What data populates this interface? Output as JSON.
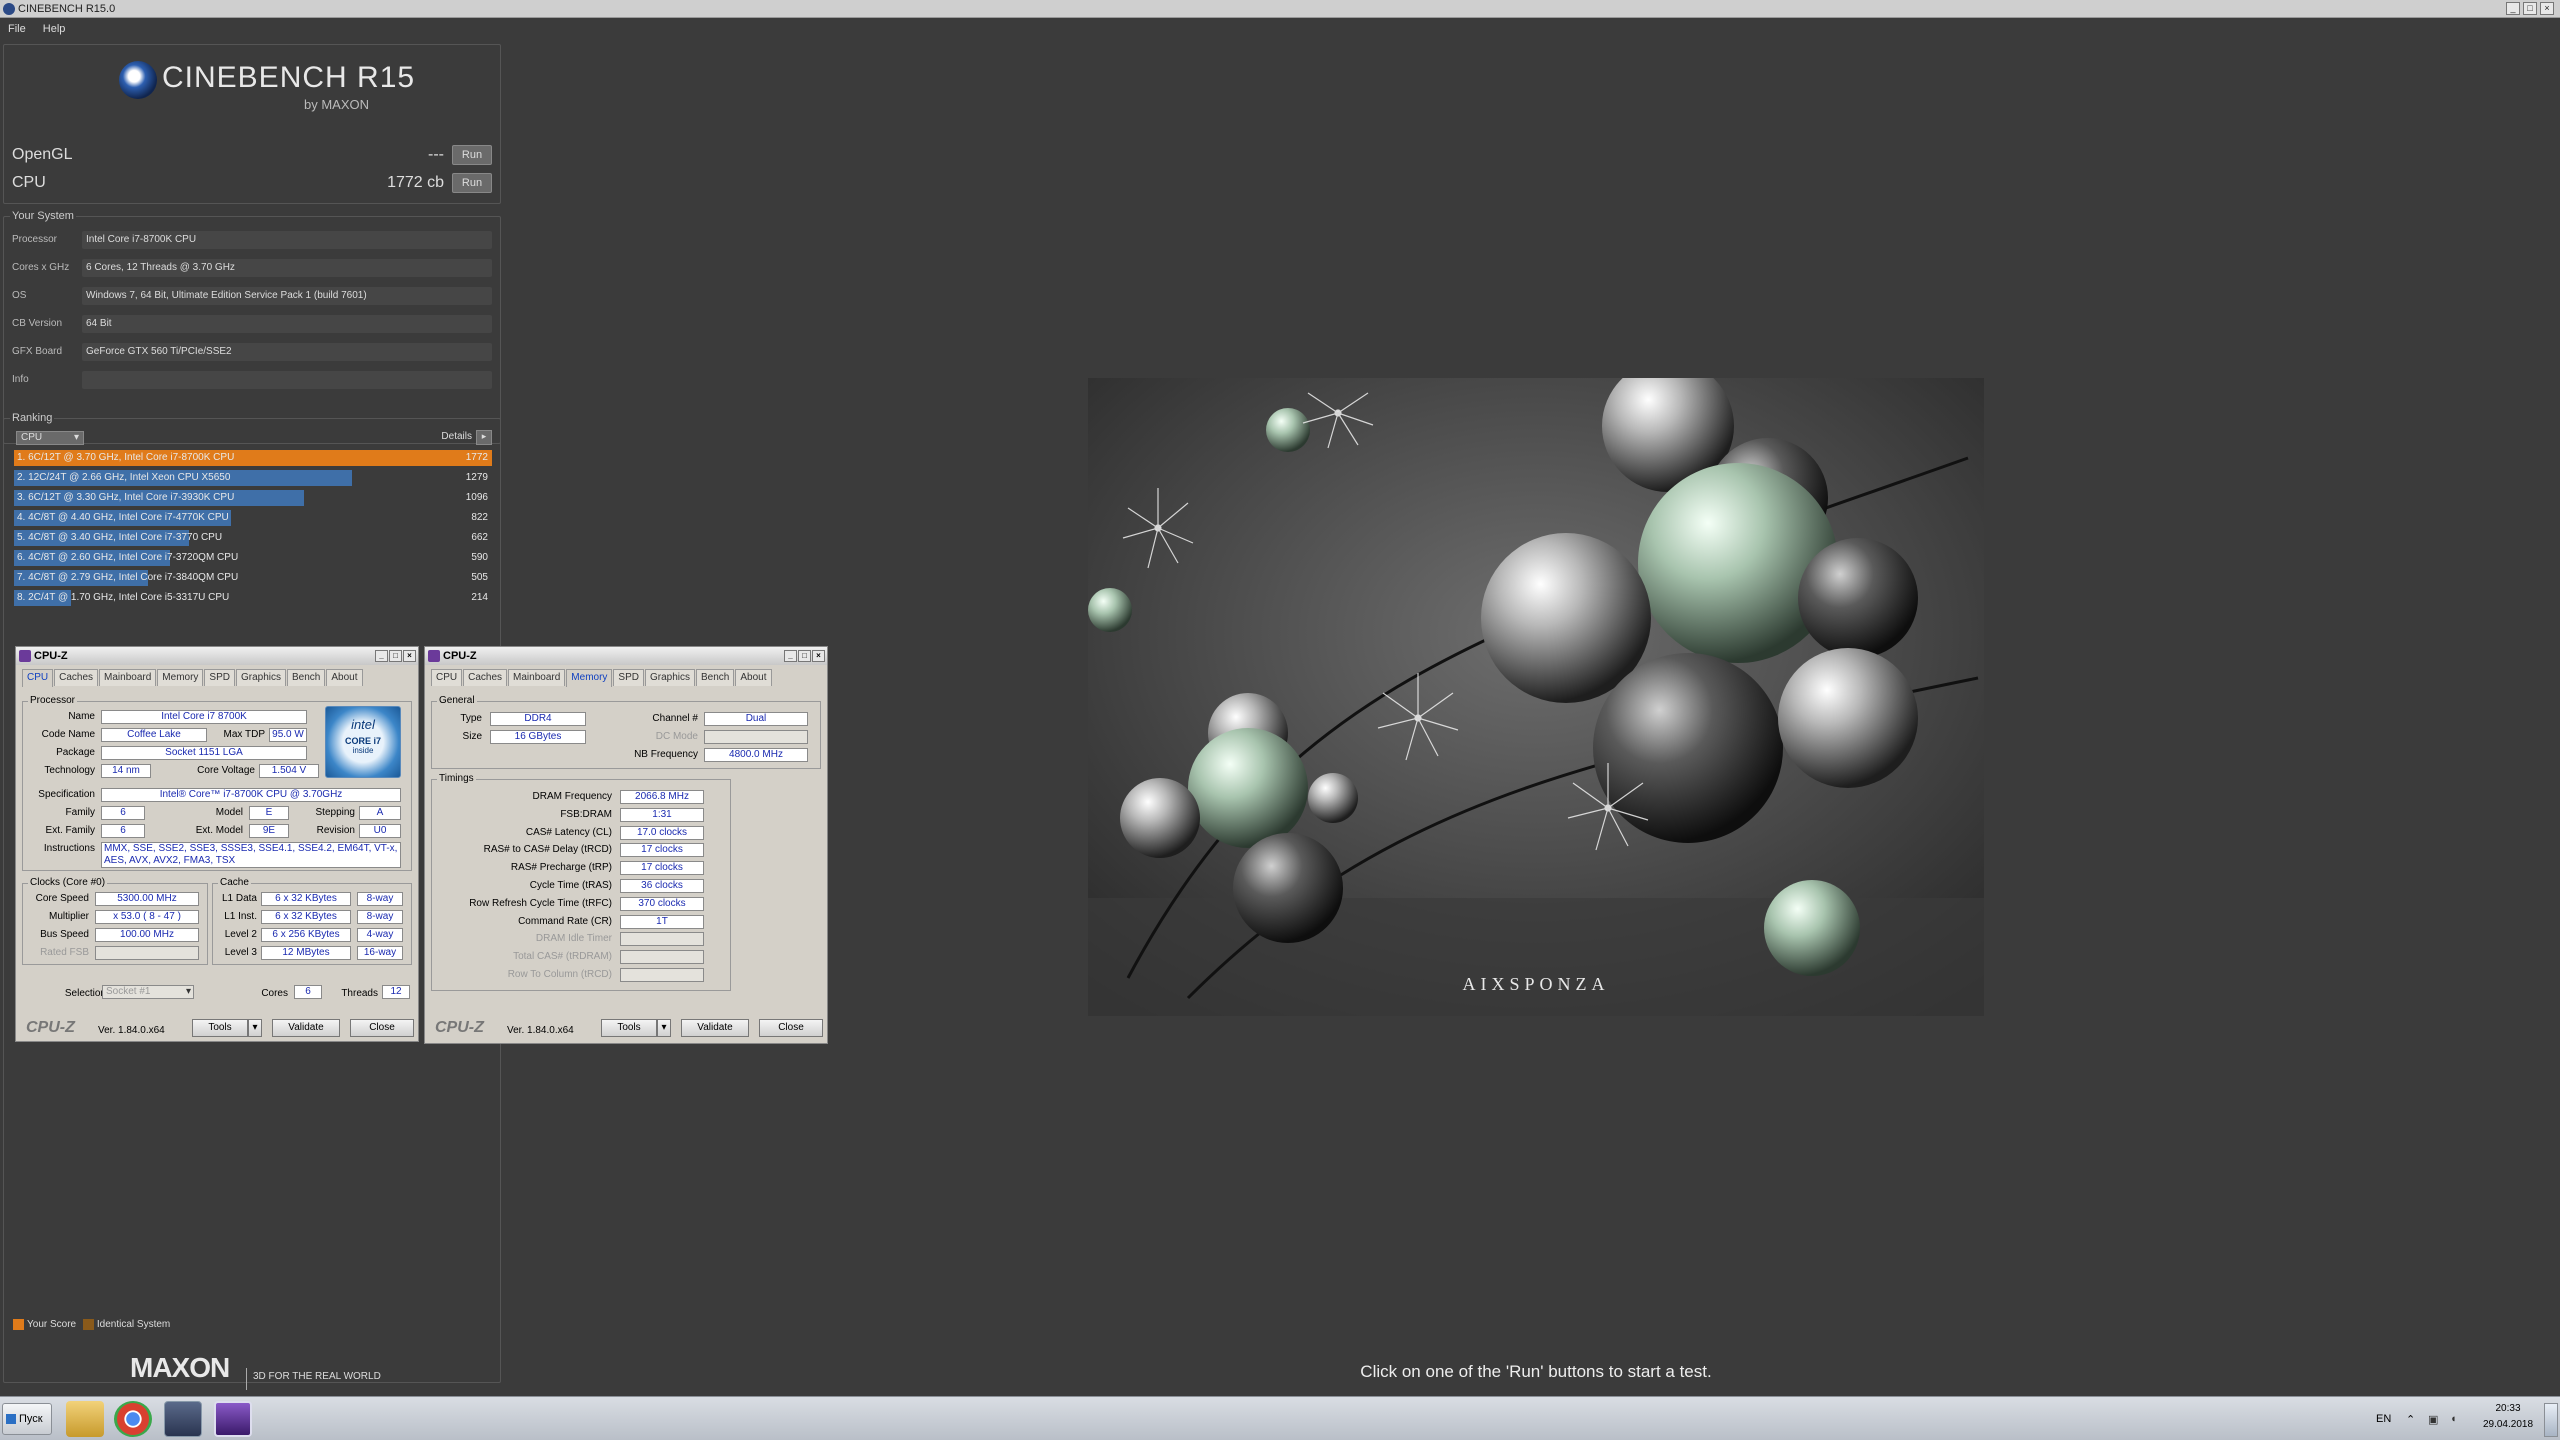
{
  "window": {
    "title": "CINEBENCH R15.0",
    "min": "_",
    "max": "□",
    "close": "×"
  },
  "menu": [
    "File",
    "Help"
  ],
  "logo": {
    "title": "CINEBENCH R15",
    "sub": "by MAXON"
  },
  "tests": [
    {
      "name": "OpenGL",
      "value": "---",
      "run": "Run"
    },
    {
      "name": "CPU",
      "value": "1772 cb",
      "run": "Run"
    }
  ],
  "system": {
    "title": "Your System",
    "rows": [
      {
        "k": "Processor",
        "v": "Intel Core i7-8700K CPU"
      },
      {
        "k": "Cores x GHz",
        "v": "6 Cores, 12 Threads @ 3.70 GHz"
      },
      {
        "k": "OS",
        "v": "Windows 7, 64 Bit, Ultimate Edition Service Pack 1 (build 7601)"
      },
      {
        "k": "CB Version",
        "v": "64 Bit"
      },
      {
        "k": "GFX Board",
        "v": "GeForce GTX 560 Ti/PCIe/SSE2"
      },
      {
        "k": "Info",
        "v": ""
      }
    ]
  },
  "ranking": {
    "title": "Ranking",
    "selector": "CPU",
    "details": "Details",
    "rows": [
      {
        "label": "1. 6C/12T @ 3.70 GHz, Intel Core i7-8700K CPU",
        "score": "1772",
        "fraction": 1.0,
        "highlight": true
      },
      {
        "label": "2. 12C/24T @ 2.66 GHz, Intel Xeon CPU X5650",
        "score": "1279",
        "fraction": 0.722
      },
      {
        "label": "3. 6C/12T @ 3.30 GHz,  Intel Core i7-3930K CPU",
        "score": "1096",
        "fraction": 0.619
      },
      {
        "label": "4. 4C/8T @ 4.40 GHz, Intel Core i7-4770K CPU",
        "score": "822",
        "fraction": 0.464
      },
      {
        "label": "5. 4C/8T @ 3.40 GHz,  Intel Core i7-3770 CPU",
        "score": "662",
        "fraction": 0.374
      },
      {
        "label": "6. 4C/8T @ 2.60 GHz, Intel Core i7-3720QM CPU",
        "score": "590",
        "fraction": 0.333
      },
      {
        "label": "7. 4C/8T @ 2.79 GHz,  Intel Core i7-3840QM CPU",
        "score": "505",
        "fraction": 0.285
      },
      {
        "label": "8. 2C/4T @ 1.70 GHz,  Intel Core i5-3317U CPU",
        "score": "214",
        "fraction": 0.121
      }
    ]
  },
  "legend": {
    "your": "Your Score",
    "identical": "Identical System"
  },
  "maxon": {
    "logo": "MAXON",
    "tagline": "3D FOR THE REAL WORLD"
  },
  "status": "Click on one of the 'Run' buttons to start a test.",
  "cpuz1": {
    "title": "CPU-Z",
    "tabs": [
      "CPU",
      "Caches",
      "Mainboard",
      "Memory",
      "SPD",
      "Graphics",
      "Bench",
      "About"
    ],
    "processor": {
      "title": "Processor",
      "name_l": "Name",
      "name": "Intel Core i7 8700K",
      "code_l": "Code Name",
      "code": "Coffee Lake",
      "tdp_l": "Max TDP",
      "tdp": "95.0 W",
      "pkg_l": "Package",
      "pkg": "Socket 1151 LGA",
      "tech_l": "Technology",
      "tech": "14 nm",
      "volt_l": "Core Voltage",
      "volt": "1.504 V",
      "spec_l": "Specification",
      "spec": "Intel® Core™ i7-8700K CPU @ 3.70GHz",
      "fam_l": "Family",
      "fam": "6",
      "model_l": "Model",
      "model": "E",
      "step_l": "Stepping",
      "step": "A",
      "efam_l": "Ext. Family",
      "efam": "6",
      "emod_l": "Ext. Model",
      "emod": "9E",
      "rev_l": "Revision",
      "rev": "U0",
      "inst_l": "Instructions",
      "inst": "MMX, SSE, SSE2, SSE3, SSSE3, SSE4.1, SSE4.2, EM64T, VT-x, AES, AVX, AVX2, FMA3, TSX",
      "badge1": "intel",
      "badge2": "CORE i7",
      "badge3": "inside"
    },
    "clocks": {
      "title": "Clocks (Core #0)",
      "cs_l": "Core Speed",
      "cs": "5300.00 MHz",
      "mul_l": "Multiplier",
      "mul": "x 53.0 ( 8 - 47 )",
      "bus_l": "Bus Speed",
      "bus": "100.00 MHz",
      "fsb_l": "Rated FSB",
      "fsb": ""
    },
    "cache": {
      "title": "Cache",
      "l1d_l": "L1 Data",
      "l1d": "6 x 32 KBytes",
      "l1d_w": "8-way",
      "l1i_l": "L1 Inst.",
      "l1i": "6 x 32 KBytes",
      "l1i_w": "8-way",
      "l2_l": "Level 2",
      "l2": "6 x 256 KBytes",
      "l2_w": "4-way",
      "l3_l": "Level 3",
      "l3": "12 MBytes",
      "l3_w": "16-way"
    },
    "sel_l": "Selection",
    "sel": "Socket #1",
    "cores_l": "Cores",
    "cores": "6",
    "threads_l": "Threads",
    "threads": "12",
    "logo": "CPU-Z",
    "ver": "Ver. 1.84.0.x64",
    "tools": "Tools",
    "validate": "Validate",
    "close": "Close"
  },
  "cpuz2": {
    "title": "CPU-Z",
    "tabs": [
      "CPU",
      "Caches",
      "Mainboard",
      "Memory",
      "SPD",
      "Graphics",
      "Bench",
      "About"
    ],
    "general": {
      "title": "General",
      "type_l": "Type",
      "type": "DDR4",
      "size_l": "Size",
      "size": "16 GBytes",
      "chan_l": "Channel #",
      "chan": "Dual",
      "dc_l": "DC Mode",
      "dc": "",
      "nb_l": "NB Frequency",
      "nb": "4800.0 MHz"
    },
    "timings": {
      "title": "Timings",
      "rows": [
        {
          "k": "DRAM Frequency",
          "v": "2066.8 MHz"
        },
        {
          "k": "FSB:DRAM",
          "v": "1:31"
        },
        {
          "k": "CAS# Latency (CL)",
          "v": "17.0 clocks"
        },
        {
          "k": "RAS# to CAS# Delay (tRCD)",
          "v": "17 clocks"
        },
        {
          "k": "RAS# Precharge (tRP)",
          "v": "17 clocks"
        },
        {
          "k": "Cycle Time (tRAS)",
          "v": "36 clocks"
        },
        {
          "k": "Row Refresh Cycle Time (tRFC)",
          "v": "370 clocks"
        },
        {
          "k": "Command Rate (CR)",
          "v": "1T"
        },
        {
          "k": "DRAM Idle Timer",
          "v": ""
        },
        {
          "k": "Total CAS# (tRDRAM)",
          "v": ""
        },
        {
          "k": "Row To Column (tRCD)",
          "v": ""
        }
      ]
    },
    "logo": "CPU-Z",
    "ver": "Ver. 1.84.0.x64",
    "tools": "Tools",
    "validate": "Validate",
    "close": "Close"
  },
  "render": {
    "watermark": "AIXSPONZA"
  },
  "taskbar": {
    "start": "Пуск",
    "lang": "EN",
    "time": "20:33",
    "date": "29.04.2018"
  }
}
